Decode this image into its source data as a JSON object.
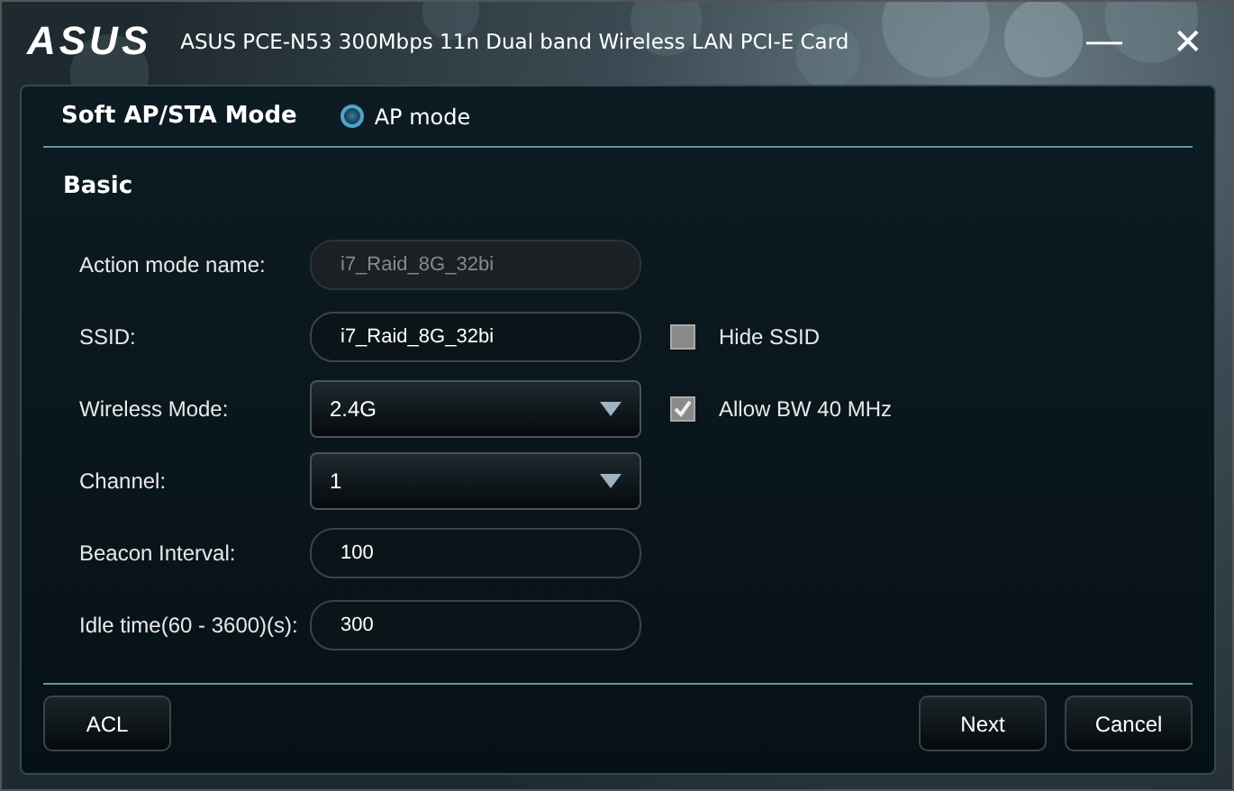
{
  "window": {
    "logo": "ASUS",
    "title": "ASUS PCE-N53 300Mbps 11n Dual band Wireless LAN PCI-E Card",
    "minimize": "—",
    "close": "✕"
  },
  "mode": {
    "label": "Soft AP/STA Mode",
    "options": [
      {
        "label": "AP mode",
        "selected": true
      }
    ]
  },
  "section": "Basic",
  "fields": [
    {
      "label": "Action mode name:",
      "kind": "text",
      "value": "i7_Raid_8G_32bi",
      "disabled": true
    },
    {
      "label": "SSID:",
      "kind": "text",
      "value": "i7_Raid_8G_32bi",
      "disabled": false,
      "option": {
        "label": "Hide SSID",
        "checked": false
      }
    },
    {
      "label": "Wireless Mode:",
      "kind": "select",
      "value": "2.4G",
      "option": {
        "label": "Allow BW 40 MHz",
        "checked": true
      }
    },
    {
      "label": "Channel:",
      "kind": "select",
      "value": "1"
    },
    {
      "label": "Beacon Interval:",
      "kind": "text",
      "value": "100",
      "disabled": false
    },
    {
      "label": "Idle time(60 - 3600)(s):",
      "kind": "text",
      "value": "300",
      "disabled": false
    }
  ],
  "buttons_left": [
    "ACL"
  ],
  "buttons_right": [
    "Next",
    "Cancel"
  ]
}
